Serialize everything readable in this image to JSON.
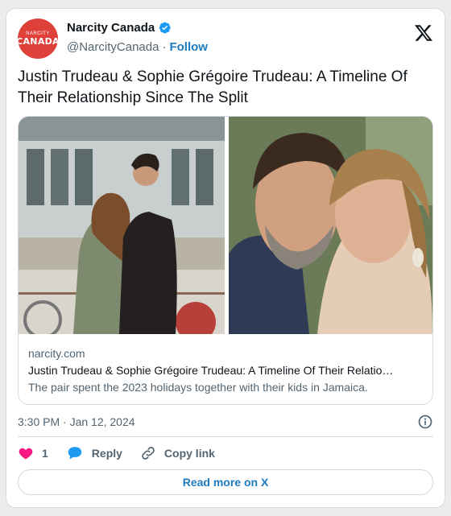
{
  "author": {
    "avatar_text_small": "NARCITY",
    "avatar_text_big": "CANADA",
    "display_name": "Narcity Canada",
    "handle": "@NarcityCanada",
    "separator": "·",
    "follow_label": "Follow"
  },
  "post": {
    "text": "Justin Trudeau & Sophie Grégoire Trudeau: A Timeline Of Their Relationship Since The Split"
  },
  "link_card": {
    "domain": "narcity.com",
    "title": "Justin Trudeau & Sophie Grégoire Trudeau: A Timeline Of Their Relatio…",
    "description": "The pair spent the 2023 holidays together with their kids in Jamaica."
  },
  "meta": {
    "timestamp": "3:30 PM · Jan 12, 2024"
  },
  "actions": {
    "like_count": "1",
    "reply_label": "Reply",
    "copy_link_label": "Copy link"
  },
  "footer": {
    "read_more_label": "Read more on X"
  },
  "icons": {
    "verified": "verified-badge-icon",
    "x_logo": "x-logo-icon",
    "info": "info-icon",
    "heart": "heart-icon",
    "reply": "reply-bubble-icon",
    "link": "link-icon"
  },
  "colors": {
    "accent": "#1d7bbf",
    "heart": "#f91880",
    "avatar": "#e0403a",
    "secondary_text": "#536471"
  }
}
